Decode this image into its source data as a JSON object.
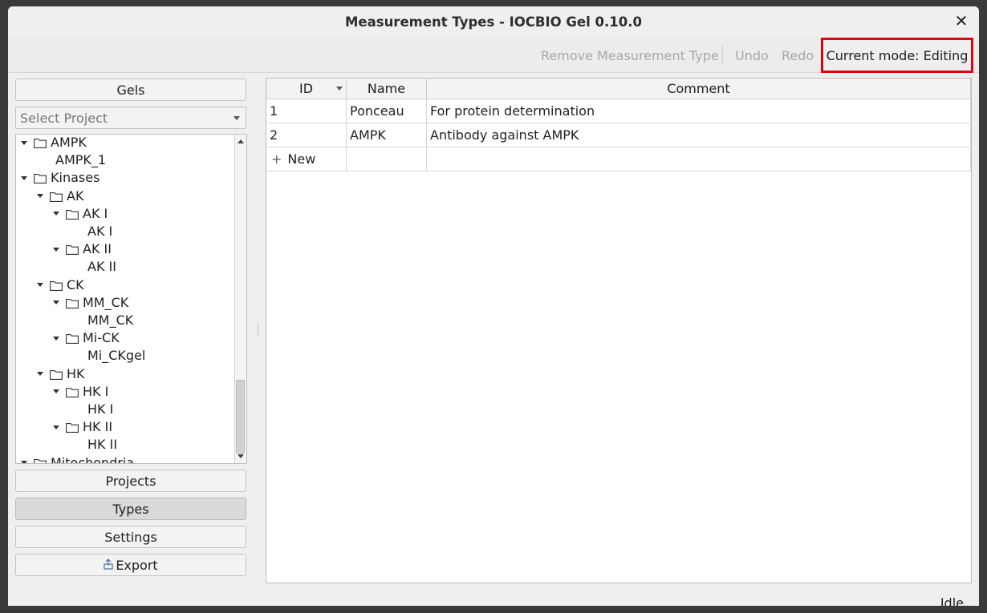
{
  "window": {
    "title": "Measurement Types - IOCBIO Gel 0.10.0",
    "close_glyph": "✕"
  },
  "toolbar": {
    "remove_label": "Remove Measurement Type",
    "undo_label": "Undo",
    "redo_label": "Redo",
    "mode_label": "Current mode: Editing"
  },
  "sidebar": {
    "gels_label": "Gels",
    "select_project_placeholder": "Select Project",
    "tree": [
      {
        "label": "AMPK",
        "depth": 0,
        "folder": true,
        "expanded": true
      },
      {
        "label": "AMPK_1",
        "depth": 1,
        "folder": false
      },
      {
        "label": "Kinases",
        "depth": 0,
        "folder": true,
        "expanded": true
      },
      {
        "label": "AK",
        "depth": 1,
        "folder": true,
        "expanded": true
      },
      {
        "label": "AK I",
        "depth": 2,
        "folder": true,
        "expanded": true
      },
      {
        "label": "AK I",
        "depth": 3,
        "folder": false
      },
      {
        "label": "AK II",
        "depth": 2,
        "folder": true,
        "expanded": true
      },
      {
        "label": "AK II",
        "depth": 3,
        "folder": false
      },
      {
        "label": "CK",
        "depth": 1,
        "folder": true,
        "expanded": true
      },
      {
        "label": "MM_CK",
        "depth": 2,
        "folder": true,
        "expanded": true
      },
      {
        "label": "MM_CK",
        "depth": 3,
        "folder": false
      },
      {
        "label": "Mi-CK",
        "depth": 2,
        "folder": true,
        "expanded": true
      },
      {
        "label": "Mi_CKgel",
        "depth": 3,
        "folder": false
      },
      {
        "label": "HK",
        "depth": 1,
        "folder": true,
        "expanded": true
      },
      {
        "label": "HK I",
        "depth": 2,
        "folder": true,
        "expanded": true
      },
      {
        "label": "HK I",
        "depth": 3,
        "folder": false
      },
      {
        "label": "HK II",
        "depth": 2,
        "folder": true,
        "expanded": true
      },
      {
        "label": "HK II",
        "depth": 3,
        "folder": false
      },
      {
        "label": "Mitochondria",
        "depth": 0,
        "folder": true,
        "expanded": true
      }
    ],
    "projects_label": "Projects",
    "types_label": "Types",
    "settings_label": "Settings",
    "export_label": "Export",
    "export_icon": "export-icon"
  },
  "table": {
    "columns": [
      "ID",
      "Name",
      "Comment"
    ],
    "rows": [
      {
        "id": "1",
        "name": "Ponceau",
        "comment": "For protein determination"
      },
      {
        "id": "2",
        "name": "AMPK",
        "comment": "Antibody against AMPK"
      }
    ],
    "new_row_label": "New",
    "new_row_glyph": "+"
  },
  "status": {
    "text": "Idle"
  }
}
